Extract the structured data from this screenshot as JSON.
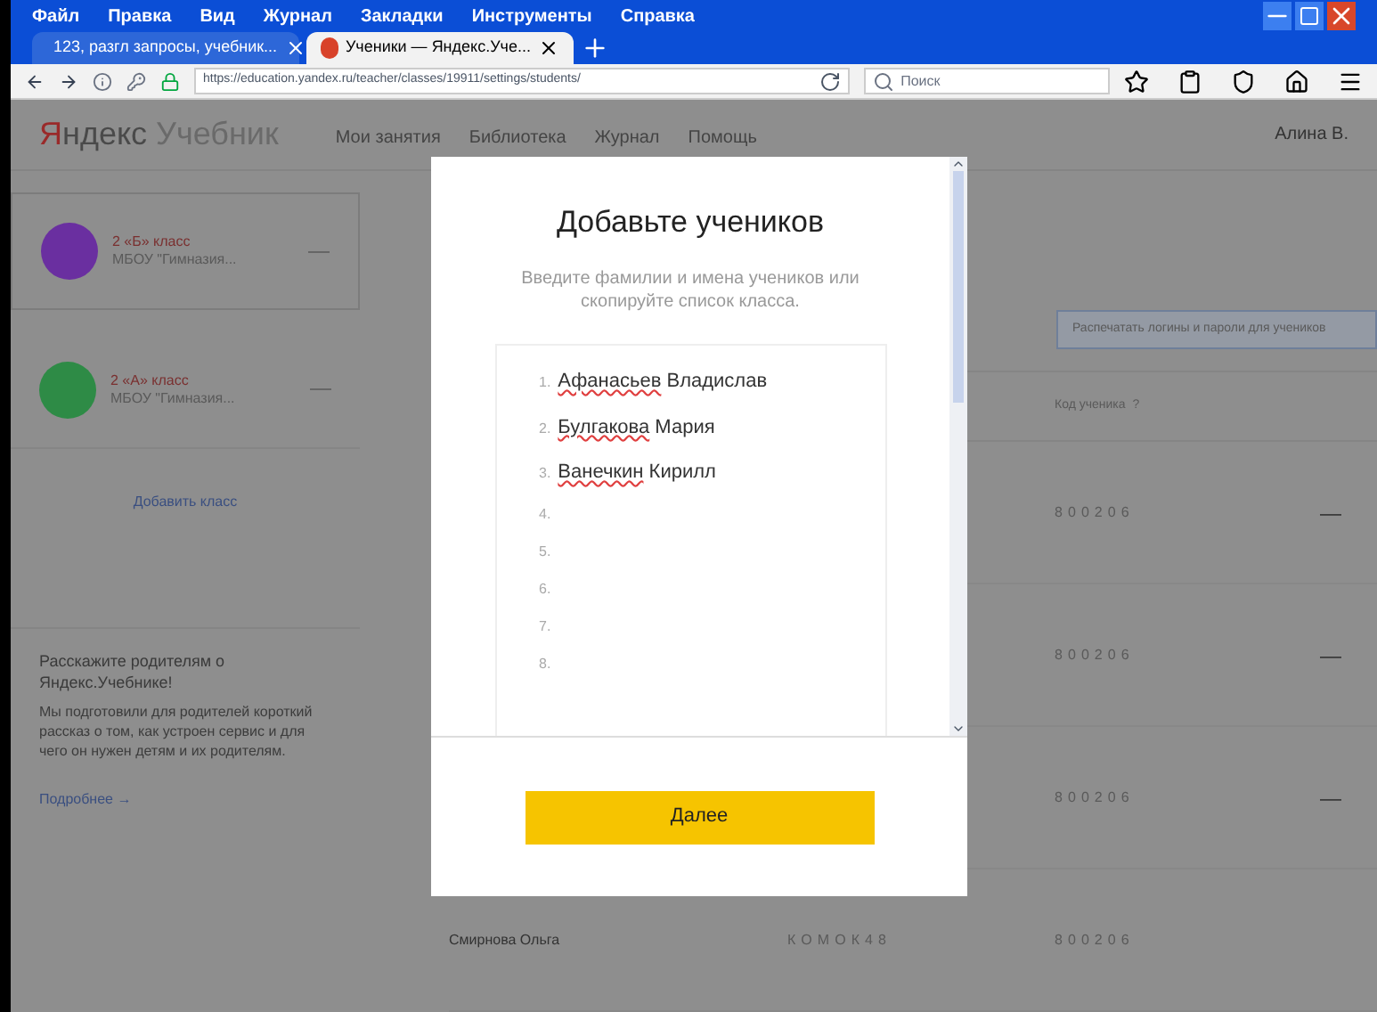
{
  "menu_bar": [
    "Файл",
    "Правка",
    "Вид",
    "Журнал",
    "Закладки",
    "Инструменты",
    "Справка"
  ],
  "tabs": [
    {
      "label": "123, разгл запросы, учебник...",
      "selected": false
    },
    {
      "label": "Ученики — Яндекс.Уче...",
      "selected": true
    }
  ],
  "address_bar": {
    "url": "https://education.yandex.ru/teacher/classes/19911/settings/students/",
    "search_placeholder": "Поиск"
  },
  "site": {
    "logo_red": "Я",
    "logo_rest": "ндекс",
    "logo_product": "Учебник",
    "nav": [
      "Мои занятия",
      "Библиотека",
      "Журнал",
      "Помощь"
    ],
    "user": "Алина В."
  },
  "classes": [
    {
      "name": "2 «Б» класс",
      "school": "МБОУ \"Гимназия...",
      "color": "#6a2fa0",
      "selected": true
    },
    {
      "name": "2 «А» класс",
      "school": "МБОУ \"Гимназия...",
      "color": "#2e8b46",
      "selected": false
    }
  ],
  "add_class": "Добавить класс",
  "promo": {
    "title": "Расскажите родителям о Яндекс.Учебнике!",
    "text": "Мы подготовили для родителей короткий рассказ о том, как устроен сервис и для чего он нужен детям и их родителям.",
    "link": "Подробнее →"
  },
  "print_field": {
    "placeholder": "Распечатать логины и пароли для учеников"
  },
  "table": {
    "code_header": "Код ученика",
    "help": "?",
    "rows": [
      {
        "code": "8 0 0 2 0 6",
        "menu": "—"
      },
      {
        "code": "8 0 0 2 0 6",
        "menu": "—"
      },
      {
        "code": "8 0 0 2 0 6",
        "menu": "—"
      },
      {
        "name": "Смирнова Ольга",
        "login": "К О М О К 4 8",
        "code": "8 0 0 2 0 6"
      }
    ]
  },
  "modal": {
    "title": "Добавьте учеников",
    "subtitle": "Введите фамилии и имена учеников или скопируйте список класса.",
    "lines": [
      {
        "number": "1.",
        "surname": "Афанасьев",
        "given_name": "Владислав"
      },
      {
        "number": "2.",
        "surname": "Булгакова",
        "given_name": "Мария"
      },
      {
        "number": "3.",
        "surname": "Ванечкин",
        "given_name": "Кирилл"
      },
      {
        "number": "4."
      },
      {
        "number": "5."
      },
      {
        "number": "6."
      },
      {
        "number": "7."
      },
      {
        "number": "8."
      }
    ],
    "button": "Далее"
  }
}
